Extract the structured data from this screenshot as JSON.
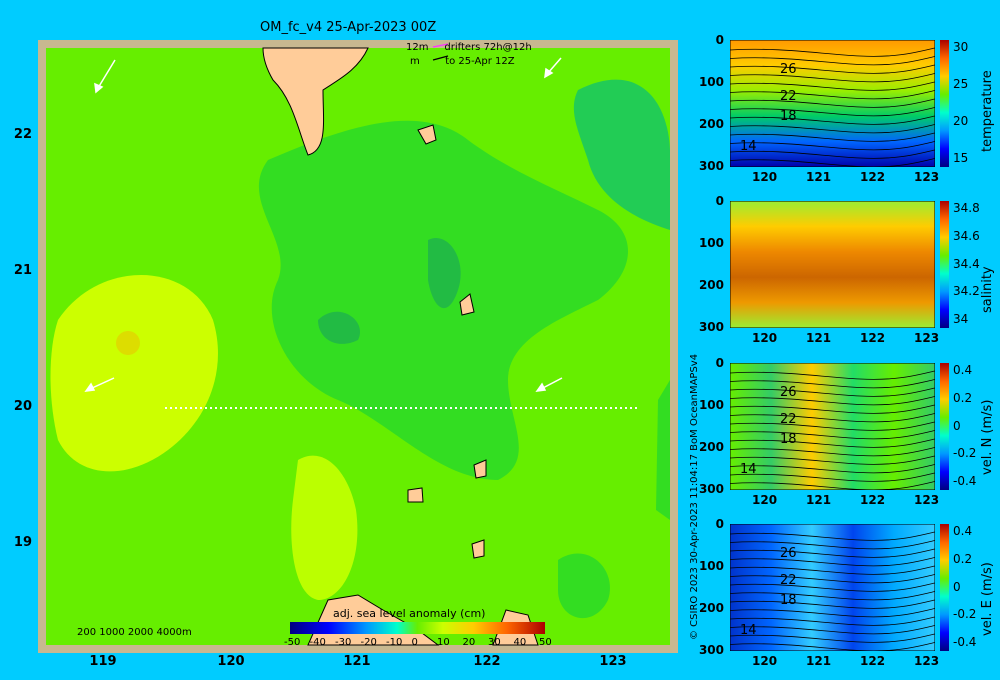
{
  "map": {
    "title": "OM_fc_v4  25-Apr-2023 00Z",
    "legend_line1": "12m",
    "legend_line1b": "drifters 72h@12h",
    "legend_line2": "m",
    "legend_line2b": "to 25-Apr 12Z",
    "depth_legend": "200  1000  2000  4000m",
    "colorbar_label": "adj. sea level anomaly (cm)",
    "colorbar_ticks": [
      "-50",
      "-40",
      "-30",
      "-20",
      "-10",
      "0",
      "10",
      "20",
      "30",
      "40",
      "50"
    ],
    "xticks": [
      "119",
      "120",
      "121",
      "122",
      "123"
    ],
    "yticks": [
      "22",
      "21",
      "20",
      "19"
    ],
    "credit": "© CSIRO 2023    30-Apr-2023 11:04:17 BoM OceanMAPSv4"
  },
  "panels": [
    {
      "label": "temperature",
      "depth_ticks": [
        "0",
        "100",
        "200",
        "300"
      ],
      "x_ticks": [
        "120",
        "121",
        "122",
        "123"
      ],
      "cbar_ticks": [
        "30",
        "25",
        "20",
        "15"
      ],
      "contour_labels": [
        "26",
        "22",
        "18",
        "14"
      ]
    },
    {
      "label": "salinity",
      "depth_ticks": [
        "0",
        "100",
        "200",
        "300"
      ],
      "x_ticks": [
        "120",
        "121",
        "122",
        "123"
      ],
      "cbar_ticks": [
        "34.8",
        "34.6",
        "34.4",
        "34.2",
        "34"
      ],
      "contour_labels": []
    },
    {
      "label": "vel. N (m/s)",
      "depth_ticks": [
        "0",
        "100",
        "200",
        "300"
      ],
      "x_ticks": [
        "120",
        "121",
        "122",
        "123"
      ],
      "cbar_ticks": [
        "0.4",
        "0.2",
        "0",
        "-0.2",
        "-0.4"
      ],
      "contour_labels": [
        "26",
        "22",
        "18",
        "14"
      ]
    },
    {
      "label": "vel. E (m/s)",
      "depth_ticks": [
        "0",
        "100",
        "200",
        "300"
      ],
      "x_ticks": [
        "120",
        "121",
        "122",
        "123"
      ],
      "cbar_ticks": [
        "0.4",
        "0.2",
        "0",
        "-0.2",
        "-0.4"
      ],
      "contour_labels": [
        "26",
        "22",
        "18",
        "14"
      ]
    }
  ],
  "chart_data": [
    {
      "type": "heatmap",
      "title": "OM_fc_v4  25-Apr-2023 00Z",
      "colorbar": "adj. sea level anomaly (cm)",
      "xlim": [
        118.5,
        123.5
      ],
      "ylim": [
        18.2,
        22.7
      ],
      "clim": [
        -50,
        50
      ],
      "section_line": {
        "lon": [
          119.5,
          123.2
        ],
        "lat": [
          20.0,
          20.0
        ]
      }
    },
    {
      "type": "heatmap",
      "label": "temperature",
      "xlim": [
        119.6,
        123.3
      ],
      "ylim": [
        300,
        0
      ],
      "clim": [
        13,
        31
      ]
    },
    {
      "type": "heatmap",
      "label": "salinity",
      "xlim": [
        119.6,
        123.3
      ],
      "ylim": [
        300,
        0
      ],
      "clim": [
        33.8,
        34.9
      ]
    },
    {
      "type": "heatmap",
      "label": "vel. N (m/s)",
      "xlim": [
        119.6,
        123.3
      ],
      "ylim": [
        300,
        0
      ],
      "clim": [
        -0.45,
        0.45
      ]
    },
    {
      "type": "heatmap",
      "label": "vel. E (m/s)",
      "xlim": [
        119.6,
        123.3
      ],
      "ylim": [
        300,
        0
      ],
      "clim": [
        -0.45,
        0.45
      ]
    }
  ],
  "colors": {
    "background": "#00ccff",
    "ssh_base": "#66ee00",
    "ssh_low": "#22cc33",
    "ssh_high": "#ccff00",
    "land": "#ffcc99"
  }
}
